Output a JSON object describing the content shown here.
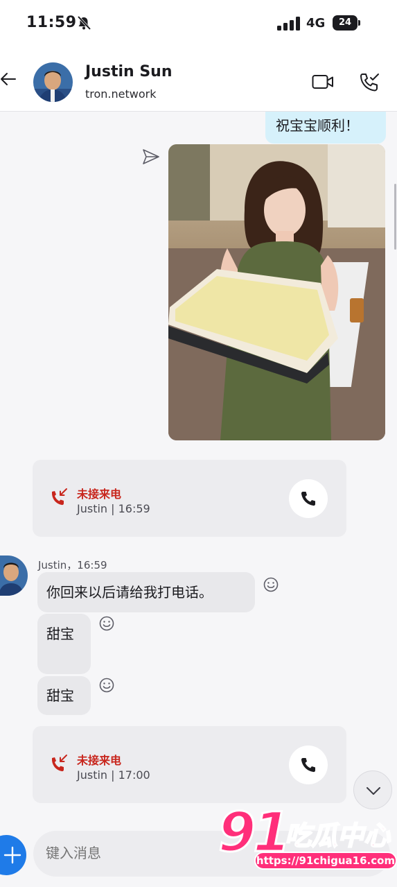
{
  "status_bar": {
    "time": "11:59",
    "network": "4G",
    "battery": "24",
    "icons": [
      "bell-muted-icon",
      "signal-icon",
      "battery-icon"
    ]
  },
  "header": {
    "contact_name": "Justin Sun",
    "contact_subtitle": "tron.network",
    "icons": [
      "back-arrow-icon",
      "video-camera-icon",
      "phone-call-icon"
    ]
  },
  "messages": {
    "outgoing_text": "祝宝宝顺利！",
    "photo_alt": "",
    "missed_call_1": {
      "title": "未接来电",
      "detail": "Justin | 16:59"
    },
    "sender_line": "Justin，16:59",
    "incoming": [
      {
        "text": "你回来以后请给我打电话。"
      },
      {
        "text": "甜宝"
      },
      {
        "text": "甜宝"
      }
    ],
    "missed_call_2": {
      "title": "未接来电",
      "detail": "Justin | 17:00"
    }
  },
  "composer": {
    "placeholder": "键入消息"
  },
  "watermark": {
    "number": "91",
    "chinese": "吃瓜中心",
    "url": "https://91chigua16.com"
  },
  "colors": {
    "accent_blue": "#1f7be8",
    "missed_red": "#c8261d",
    "outgoing_bubble": "#d6f1fb",
    "incoming_bubble": "#e8e8eb",
    "watermark_pink": "#ff2f7a"
  }
}
